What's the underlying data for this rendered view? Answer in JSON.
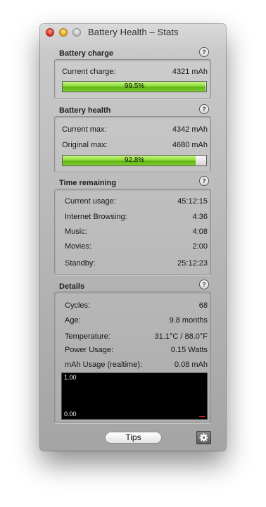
{
  "window": {
    "title": "Battery Health – Stats"
  },
  "battery_charge": {
    "heading": "Battery charge",
    "current_label": "Current charge:",
    "current_value": "4321 mAh",
    "progress_text": "99.5%",
    "progress_fraction": 0.995
  },
  "battery_health": {
    "heading": "Battery health",
    "current_max_label": "Current max:",
    "current_max_value": "4342 mAh",
    "original_max_label": "Original max:",
    "original_max_value": "4680 mAh",
    "progress_text": "92.8%",
    "progress_fraction": 0.928
  },
  "time_remaining": {
    "heading": "Time remaining",
    "rows": [
      {
        "label": "Current usage:",
        "value": "45:12:15"
      },
      {
        "label": "Internet Browsing:",
        "value": "4:36"
      },
      {
        "label": "Music:",
        "value": "4:08"
      },
      {
        "label": "Movies:",
        "value": "2:00"
      },
      {
        "label": "Standby:",
        "value": "25:12:23"
      }
    ]
  },
  "details": {
    "heading": "Details",
    "rows": [
      {
        "label": "Cycles:",
        "value": "68"
      },
      {
        "label": "Age:",
        "value": "9.8 months"
      },
      {
        "label": "Temperature:",
        "value": "31.1°C / 88.0°F"
      },
      {
        "label": "Power Usage:",
        "value": "0.15 Watts"
      },
      {
        "label": "mAh Usage (realtime):",
        "value": "0.08 mAh"
      }
    ],
    "graph": {
      "max_label": "1.00",
      "min_label": "0.00",
      "line_color": "#d01818"
    }
  },
  "help_symbol": "?",
  "footer": {
    "tips_label": "Tips",
    "settings_icon": "gear-icon"
  }
}
